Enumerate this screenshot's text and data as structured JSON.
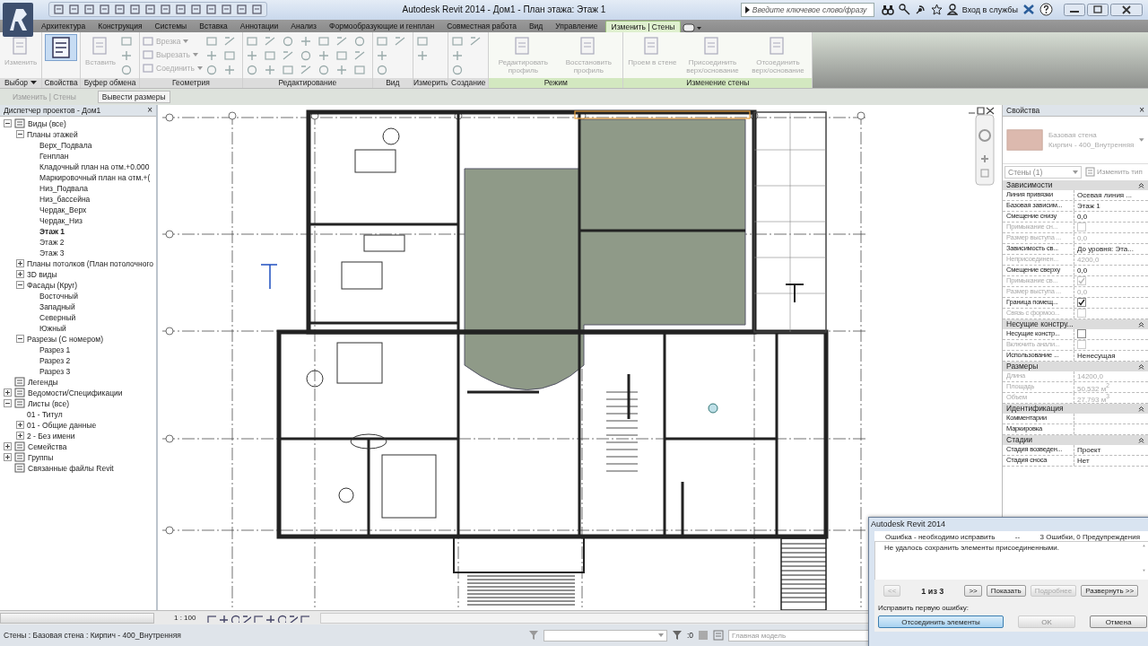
{
  "title_bar": {
    "title": "Autodesk Revit 2014 - Дом1 - План этажа: Этаж 1",
    "search": {
      "placeholder": "Введите ключевое слово/фразу"
    },
    "sign_in": "Вход в службы"
  },
  "tabs": [
    {
      "label": "Архитектура",
      "selected": false
    },
    {
      "label": "Конструкция",
      "selected": false
    },
    {
      "label": "Системы",
      "selected": false
    },
    {
      "label": "Вставка",
      "selected": false
    },
    {
      "label": "Аннотации",
      "selected": false
    },
    {
      "label": "Анализ",
      "selected": false
    },
    {
      "label": "Формообразующие и генплан",
      "selected": false
    },
    {
      "label": "Совместная работа",
      "selected": false
    },
    {
      "label": "Вид",
      "selected": false
    },
    {
      "label": "Управление",
      "selected": false
    },
    {
      "label": "Изменить | Стены",
      "selected": true
    }
  ],
  "ribbon": {
    "panels": [
      {
        "title": "Выбор",
        "dropdown": true,
        "contextual": false,
        "tools": [
          {
            "kind": "large",
            "label": "Изменить",
            "disabled": true,
            "selected": false
          }
        ]
      },
      {
        "title": "Свойства",
        "dropdown": false,
        "contextual": false,
        "tools": [
          {
            "kind": "large",
            "selected": true
          }
        ]
      },
      {
        "title": "Буфер обмена",
        "dropdown": false,
        "contextual": false,
        "tools": [
          {
            "kind": "large",
            "label": "Вставить",
            "disabled": true,
            "selected": false
          },
          {
            "kind": "icon"
          },
          {
            "kind": "icon"
          },
          {
            "kind": "icon"
          }
        ]
      },
      {
        "title": "Геометрия",
        "dropdown": false,
        "contextual": false,
        "tools": [
          {
            "kind": "small",
            "label": "Врезка",
            "disabled": true
          },
          {
            "kind": "small",
            "label": "Вырезать",
            "disabled": true
          },
          {
            "kind": "small",
            "label": "Соединить",
            "disabled": true
          },
          {
            "kind": "icon"
          },
          {
            "kind": "icon"
          },
          {
            "kind": "icon"
          },
          {
            "kind": "icon"
          },
          {
            "kind": "icon"
          },
          {
            "kind": "icon"
          }
        ]
      },
      {
        "title": "Редактирование",
        "dropdown": false,
        "contextual": false,
        "tools": [
          {
            "kind": "icon"
          },
          {
            "kind": "icon"
          },
          {
            "kind": "icon"
          },
          {
            "kind": "icon"
          },
          {
            "kind": "icon"
          },
          {
            "kind": "icon"
          },
          {
            "kind": "icon"
          },
          {
            "kind": "icon"
          },
          {
            "kind": "icon"
          },
          {
            "kind": "icon"
          },
          {
            "kind": "icon"
          },
          {
            "kind": "icon"
          },
          {
            "kind": "icon"
          },
          {
            "kind": "icon"
          },
          {
            "kind": "icon"
          },
          {
            "kind": "icon"
          },
          {
            "kind": "icon"
          },
          {
            "kind": "icon"
          },
          {
            "kind": "icon"
          },
          {
            "kind": "icon"
          },
          {
            "kind": "icon"
          }
        ]
      },
      {
        "title": "Вид",
        "dropdown": false,
        "contextual": false,
        "tools": [
          {
            "kind": "icon"
          },
          {
            "kind": "icon"
          },
          {
            "kind": "icon"
          },
          {
            "kind": "icon"
          }
        ]
      },
      {
        "title": "Измерить",
        "dropdown": false,
        "contextual": false,
        "tools": [
          {
            "kind": "icon"
          },
          {
            "kind": "icon"
          }
        ]
      },
      {
        "title": "Создание",
        "dropdown": false,
        "contextual": false,
        "tools": [
          {
            "kind": "icon"
          },
          {
            "kind": "icon"
          },
          {
            "kind": "icon"
          },
          {
            "kind": "icon"
          }
        ]
      },
      {
        "title": "Режим",
        "dropdown": false,
        "contextual": true,
        "tools": [
          {
            "kind": "large",
            "label": "Редактировать профиль",
            "disabled": true,
            "selected": false
          },
          {
            "kind": "large",
            "label": "Восстановить профиль",
            "disabled": true,
            "selected": false
          }
        ]
      },
      {
        "title": "Изменение стены",
        "dropdown": false,
        "contextual": true,
        "tools": [
          {
            "kind": "large",
            "label": "Проем в стене",
            "disabled": true,
            "selected": false
          },
          {
            "kind": "large",
            "label": "Присоединить верх/основание",
            "disabled": true,
            "selected": false
          },
          {
            "kind": "large",
            "label": "Отсоединить верх/основание",
            "disabled": true,
            "selected": false
          }
        ]
      }
    ]
  },
  "options_bar": {
    "context": "Изменить | Стены",
    "button": "Вывести размеры"
  },
  "project_browser": {
    "title": "Диспетчер проектов - Дом1",
    "close": "×",
    "tree": [
      {
        "label": "Виды (все)",
        "expanded": true,
        "selected": false,
        "children": [
          {
            "label": "Планы этажей",
            "expanded": true,
            "selected": false,
            "children": [
              {
                "label": "Верх_Подвала",
                "selected": false
              },
              {
                "label": "Генплан",
                "selected": false
              },
              {
                "label": "Кладочный план на отм.+0.000",
                "selected": false
              },
              {
                "label": "Маркировочный план на отм.+(",
                "selected": false
              },
              {
                "label": "Низ_Подвала",
                "selected": false
              },
              {
                "label": "Низ_бассейна",
                "selected": false
              },
              {
                "label": "Чердак_Верх",
                "selected": false
              },
              {
                "label": "Чердак_Низ",
                "selected": false
              },
              {
                "label": "Этаж 1",
                "selected": true
              },
              {
                "label": "Этаж 2",
                "selected": false
              },
              {
                "label": "Этаж 3",
                "selected": false
              }
            ]
          },
          {
            "label": "Планы потолков (План потолочного",
            "expanded": false,
            "selected": false
          },
          {
            "label": "3D виды",
            "expanded": false,
            "selected": false
          },
          {
            "label": "Фасады (Круг)",
            "expanded": true,
            "selected": false,
            "children": [
              {
                "label": "Восточный",
                "selected": false
              },
              {
                "label": "Западный",
                "selected": false
              },
              {
                "label": "Северный",
                "selected": false
              },
              {
                "label": "Южный",
                "selected": false
              }
            ]
          },
          {
            "label": "Разрезы (С номером)",
            "expanded": true,
            "selected": false,
            "children": [
              {
                "label": "Разрез 1",
                "selected": false
              },
              {
                "label": "Разрез 2",
                "selected": false
              },
              {
                "label": "Разрез 3",
                "selected": false
              }
            ]
          }
        ]
      },
      {
        "label": "Легенды",
        "selected": false
      },
      {
        "label": "Ведомости/Спецификации",
        "expanded": false,
        "selected": false
      },
      {
        "label": "Листы (все)",
        "expanded": true,
        "selected": false,
        "children": [
          {
            "label": "01 - Титул",
            "selected": false
          },
          {
            "label": "01 - Общие данные",
            "expanded": false,
            "selected": false
          },
          {
            "label": "2 - Без имени",
            "expanded": false,
            "selected": false
          }
        ]
      },
      {
        "label": "Семейства",
        "expanded": false,
        "selected": false
      },
      {
        "label": "Группы",
        "expanded": false,
        "selected": false
      },
      {
        "label": "Связанные файлы Revit",
        "selected": false
      }
    ]
  },
  "view": {
    "scale": "1 : 100"
  },
  "properties": {
    "title": "Свойства",
    "close": "×",
    "type_name": "Базовая стена",
    "type_sub": "Кирпич - 400_Внутренняя",
    "selector": "Стены (1)",
    "edit_type": "Изменить тип",
    "groups": [
      {
        "title": "Зависимости",
        "rows": [
          {
            "kind": "text",
            "label": "Линия привязки",
            "value": "Осевая линия ...",
            "disabled": false
          },
          {
            "kind": "text",
            "label": "Базовая зависим...",
            "value": "Этаж 1",
            "disabled": false
          },
          {
            "kind": "text",
            "label": "Смещение снизу",
            "value": "0,0",
            "disabled": false
          },
          {
            "kind": "checkbox",
            "label": "Примыкание сн...",
            "checked": false,
            "disabled": true
          },
          {
            "kind": "text",
            "label": "Размер выступа ...",
            "value": "0,0",
            "disabled": true
          },
          {
            "kind": "text",
            "label": "Зависимость св...",
            "value": "До уровня: Эта...",
            "disabled": false
          },
          {
            "kind": "text",
            "label": "Неприсоединен...",
            "value": "4200,0",
            "disabled": true
          },
          {
            "kind": "text",
            "label": "Смещение сверху",
            "value": "0,0",
            "disabled": false
          },
          {
            "kind": "checkbox",
            "label": "Примыкание св...",
            "checked": true,
            "disabled": true
          },
          {
            "kind": "text",
            "label": "Размер выступа ...",
            "value": "0,0",
            "disabled": true
          },
          {
            "kind": "checkbox",
            "label": "Граница помещ...",
            "checked": true,
            "disabled": false
          },
          {
            "kind": "checkbox",
            "label": "Связь с формоо...",
            "checked": false,
            "disabled": true
          }
        ]
      },
      {
        "title": "Несущие констру...",
        "rows": [
          {
            "kind": "checkbox",
            "label": "Несущие констр...",
            "checked": false,
            "disabled": false
          },
          {
            "kind": "checkbox",
            "label": "Включить анали...",
            "checked": false,
            "disabled": true
          },
          {
            "kind": "text",
            "label": "Использование ...",
            "value": "Ненесущая",
            "disabled": false
          }
        ]
      },
      {
        "title": "Размеры",
        "rows": [
          {
            "kind": "text",
            "label": "Длина",
            "value": "14200,0",
            "disabled": true
          },
          {
            "kind": "text",
            "label": "Площадь",
            "value": "50,532 м$^{2}$",
            "disabled": true
          },
          {
            "kind": "text",
            "label": "Объем",
            "value": "27,793 м$^{3}$",
            "disabled": true
          }
        ]
      },
      {
        "title": "Идентификация",
        "rows": [
          {
            "kind": "text",
            "label": "Комментарии",
            "disabled": false
          },
          {
            "kind": "text",
            "label": "Маркировка",
            "disabled": false
          }
        ]
      },
      {
        "title": "Стадии",
        "rows": [
          {
            "kind": "text",
            "label": "Стадия возведен...",
            "value": "Проект",
            "disabled": false
          },
          {
            "kind": "text",
            "label": "Стадия сноса",
            "value": "Нет",
            "disabled": false
          }
        ]
      }
    ]
  },
  "status_bar": {
    "text": "Стены : Базовая стена : Кирпич - 400_Внутренняя",
    "count": ":0",
    "workset": "Главная модель"
  },
  "dialog": {
    "title": "Autodesk Revit 2014",
    "severity": "Ошибка - необходимо исправить",
    "separator": "--",
    "summary": "3 Ошибки, 0 Предупреждения",
    "message": "Не удалось сохранить элементы присоединенными.",
    "pager": "1 из 3",
    "buttons": [
      {
        "label": "<<",
        "disabled": true
      },
      {
        "label": ">>",
        "disabled": false
      },
      {
        "label": "Показать",
        "disabled": false
      },
      {
        "label": "Подробнее",
        "disabled": true
      },
      {
        "label": "Развернуть >>",
        "disabled": false
      }
    ],
    "fix_label": "Исправить первую ошибку:",
    "actions": [
      {
        "label": "Отсоединить элементы",
        "disabled": false,
        "selected": true
      },
      {
        "label": "OK",
        "disabled": true,
        "selected": false
      },
      {
        "label": "Отмена",
        "disabled": false,
        "selected": false
      }
    ]
  }
}
